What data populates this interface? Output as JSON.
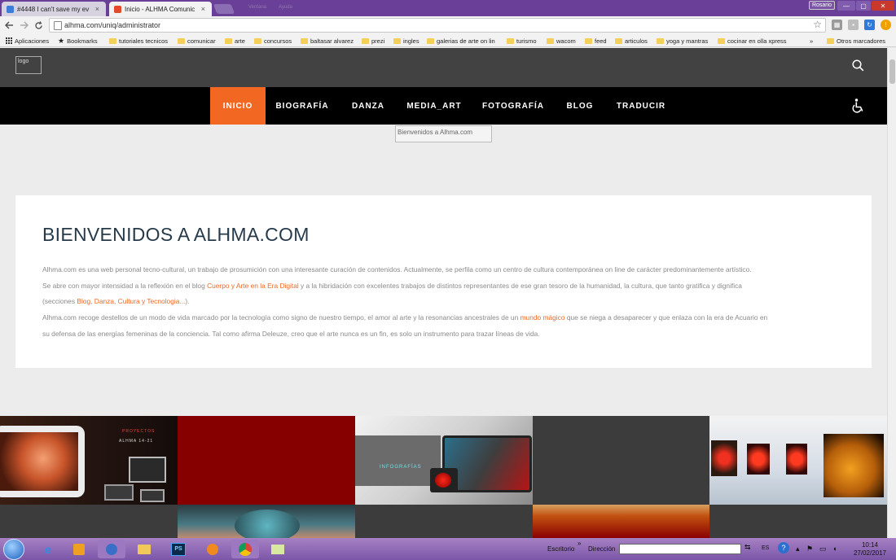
{
  "browser": {
    "tabs": [
      {
        "label": "#4448 I can't save my ev",
        "close": "×",
        "color": "#3b7dd8"
      },
      {
        "label": "Inicio - ALHMA Comunic",
        "close": "×",
        "color": "#e24a2a"
      }
    ],
    "ghost_tabs": [
      "Ventana",
      "Ayuda"
    ],
    "user": "Rosario",
    "window_buttons": [
      "—",
      "▢",
      "✕"
    ],
    "url": "alhma.com/uniq/administrator",
    "bookmarks": [
      {
        "label": "Aplicaciones",
        "kind": "apps"
      },
      {
        "label": "Bookmarks",
        "kind": "star"
      },
      {
        "label": "tutoriales tecnicos",
        "kind": "folder"
      },
      {
        "label": "comunicar",
        "kind": "folder"
      },
      {
        "label": "arte",
        "kind": "folder"
      },
      {
        "label": "concursos",
        "kind": "folder"
      },
      {
        "label": "baltasar alvarez",
        "kind": "folder"
      },
      {
        "label": "prezi",
        "kind": "folder"
      },
      {
        "label": "ingles",
        "kind": "folder"
      },
      {
        "label": "galerias de arte on lin",
        "kind": "folder"
      },
      {
        "label": "turismo",
        "kind": "folder"
      },
      {
        "label": "wacom",
        "kind": "folder"
      },
      {
        "label": "feed",
        "kind": "folder"
      },
      {
        "label": "articulos",
        "kind": "folder"
      },
      {
        "label": "yoga y mantras",
        "kind": "folder"
      },
      {
        "label": "cocinar en olla xpress",
        "kind": "folder"
      }
    ],
    "bookmarks_overflow": "»",
    "other_bookmarks": "Otros marcadores"
  },
  "site": {
    "logo_alt": "logo",
    "nav": [
      "INICIO",
      "BIOGRAFÍA",
      "DANZA",
      "MEDIA_ART",
      "FOTOGRAFÍA",
      "BLOG",
      "TRADUCIR"
    ],
    "active_nav": 0,
    "hero_alt": "Bienvenidos a Alhma.com",
    "welcome": {
      "title": "BIENVENIDOS A ALHMA.COM",
      "p1": "Alhma.com es una web personal tecno-cultural, un trabajo de prosumición con una interesante curación de contenidos. Actualmente, se perfila como un centro de cultura contemporánea on line de carácter predominantemente artístico.",
      "p2_a": "Se abre con mayor intensidad a la reflexión en el blog ",
      "p2_link": "Cuerpo y Arte en la Era Digital",
      "p2_b": " y a la hibridación con excelentes trabajos de distintos representantes de ese gran tesoro de la humanidad, la cultura, que tanto gratifica y dignifica",
      "p3_a": "(secciones ",
      "p3_l1": "Blog",
      "p3_sep1": ", ",
      "p3_l2": "Danza",
      "p3_sep2": ", ",
      "p3_l3": "Cultura y Tecnologia...",
      "p3_b": ").",
      "p4_a": "Alhma.com recoge destellos de un modo de vida marcado por la tecnología como signo de nuestro tiempo, el amor al arte y la resonancias ancestrales de un ",
      "p4_link": "mundo mágico",
      "p4_b": " que se niega a desaparecer y que enlaza con la era de Acuario en",
      "p5": "su defensa de las energías femeninas de la conciencia. Tal como afirma Deleuze, creo que el arte nunca es un fin, es solo un instrumento para trazar líneas de vida."
    },
    "gallery": {
      "tile1_caption_a": "PROYECTOS",
      "tile1_caption_b": "ALHMA 14-21",
      "tile3_caption": "INFOGRAFÍAS"
    },
    "accent": "#f26722"
  },
  "taskbar": {
    "apps": [
      "e",
      "PS"
    ],
    "escritorio": "Escritorio",
    "chevron": "»",
    "direccion": "Dirección",
    "lang": "ES",
    "time": "10:14",
    "date": "27/02/2017"
  }
}
